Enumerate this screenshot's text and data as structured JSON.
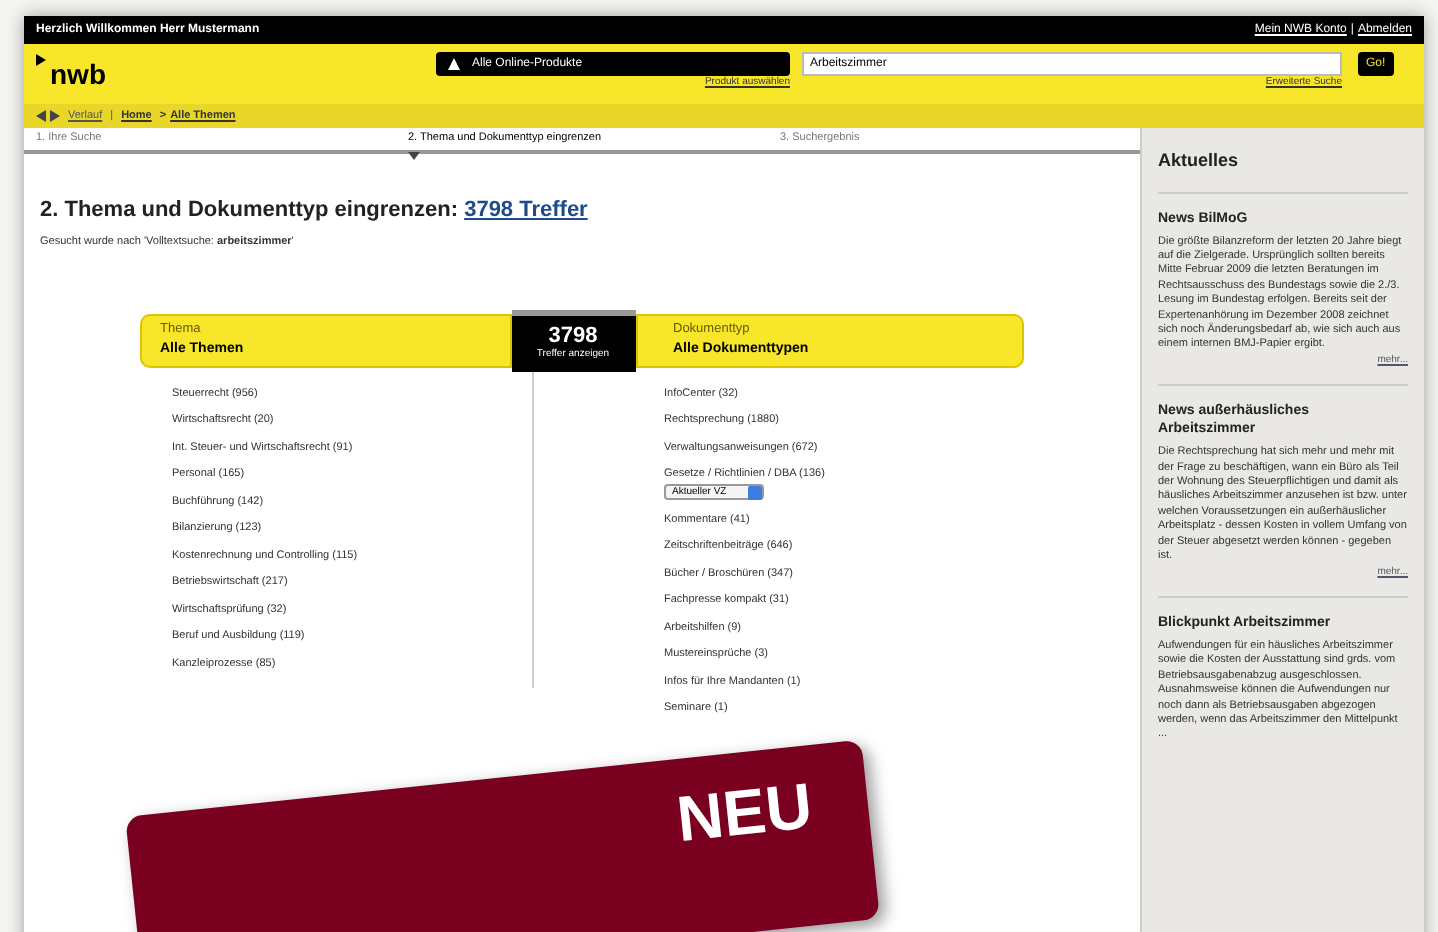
{
  "top_bar": {
    "greeting": "Herzlich Willkommen Herr Mustermann",
    "links": [
      "Mein NWB Konto",
      "Abmelden"
    ],
    "separator": "|"
  },
  "header": {
    "logo": "nwb",
    "product_button": "Alle Online-Produkte",
    "product_link": "Produkt auswählen",
    "search_value": "Arbeitszimmer",
    "go_button": "Go!",
    "advanced_link": "Erweiterte Suche"
  },
  "breadcrumb": {
    "history": "Verlauf",
    "separator": "|",
    "items": [
      "Home",
      "Alle Themen"
    ],
    "arrow": ">"
  },
  "steps": [
    {
      "label": "1. Ihre Suche",
      "selected": false
    },
    {
      "label": "2. Thema und Dokumenttyp eingrenzen",
      "selected": true
    },
    {
      "label": "3. Suchergebnis",
      "selected": false
    }
  ],
  "heading": "2. Thema und Dokumenttyp eingrenzen: ",
  "heading_link": "3798 Treffer",
  "searched_for": "Gesucht wurde nach 'Volltextsuche: **arbeitszimmer**'",
  "result_badge": {
    "count": "3798",
    "label": "Treffer anzeigen"
  },
  "topic": {
    "label": "Thema",
    "value": "Alle Themen",
    "items": [
      {
        "text": "Steuerrecht (956)"
      },
      {
        "text": "Wirtschaftsrecht (20)"
      },
      {
        "text": "Int. Steuer- und Wirtschaftsrecht (91)"
      },
      {
        "text": "Personal (165)"
      },
      {
        "text": "Buchführung (142)"
      },
      {
        "text": "Bilanzierung (123)"
      },
      {
        "text": "Kostenrechnung und Controlling (115)"
      },
      {
        "text": "Betriebswirtschaft (217)"
      },
      {
        "text": "Wirtschaftsprüfung (32)"
      },
      {
        "text": "Beruf und Ausbildung (119)"
      },
      {
        "text": "Kanzleiprozesse (85)"
      }
    ]
  },
  "doctype": {
    "label": "Dokumenttyp",
    "value": "Alle Dokumenttypen",
    "items": [
      {
        "text": "InfoCenter (32)"
      },
      {
        "text": "Rechtsprechung (1880)"
      },
      {
        "text": "Verwaltungsanweisungen (672)"
      },
      {
        "text": "Gesetze / Richtlinien / DBA (136)",
        "select": "Aktueller VZ"
      },
      {
        "text": "Kommentare (41)"
      },
      {
        "text": "Zeitschriftenbeiträge (646)"
      },
      {
        "text": "Bücher / Broschüren (347)"
      },
      {
        "text": "Fachpresse kompakt (31)"
      },
      {
        "text": "Arbeitshilfen (9)"
      },
      {
        "text": "Mustereinsprüche (3)"
      },
      {
        "text": "Infos für Ihre Mandanten (1)"
      },
      {
        "text": "Seminare (1)"
      }
    ]
  },
  "sidebar": {
    "title": "Aktuelles",
    "news": [
      {
        "title": "News BilMoG",
        "text": "Die größte Bilanzreform der letzten 20 Jahre biegt auf die Zielgerade. Ursprünglich sollten bereits Mitte Februar 2009 die letzten Beratungen im Rechtsausschuss des Bundestags sowie die 2./3. Lesung im Bundestag erfolgen. Bereits seit der Expertenanhörung im Dezember 2008 zeichnet sich noch Änderungsbedarf ab, wie sich auch aus einem internen BMJ-Papier ergibt.",
        "more": "mehr..."
      },
      {
        "title": "News außerhäusliches Arbeitszimmer",
        "text": "Die Rechtsprechung hat sich mehr und mehr mit der Frage zu beschäftigen, wann ein Büro als Teil der Wohnung des Steuerpflichtigen und damit als häusliches Arbeitszimmer anzusehen ist bzw. unter welchen Voraussetzungen ein außerhäuslicher Arbeitsplatz - dessen Kosten in vollem Umfang von der Steuer abgesetzt werden können - gegeben ist.",
        "more": "mehr..."
      },
      {
        "title": "Blickpunkt Arbeitszimmer",
        "text": "Aufwendungen für ein häusliches Arbeitszimmer sowie die Kosten der Ausstattung sind grds. vom Betriebsausgabenabzug ausgeschlossen. Ausnahmsweise können die Aufwendungen nur noch dann als Betriebsausgaben abgezogen werden, wenn das Arbeitszimmer den Mittelpunkt ..."
      }
    ]
  },
  "banner": {
    "text": "NEU"
  }
}
